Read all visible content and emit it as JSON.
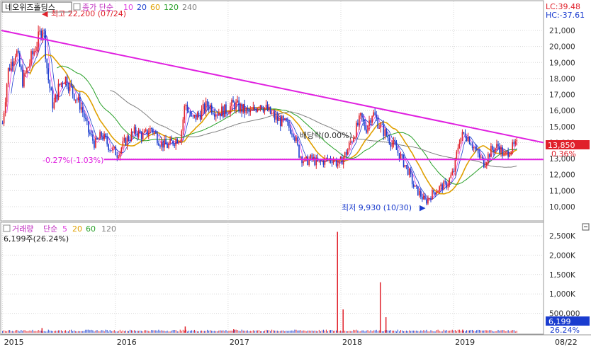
{
  "header": {
    "stock_name": "네오위즈홀딩스",
    "price_series_label": "종가 단순",
    "ma_periods": [
      "10",
      "20",
      "60",
      "120",
      "240"
    ],
    "ma_colors": [
      "#e040e0",
      "#1a3ccf",
      "#e0a000",
      "#28a028",
      "#808080"
    ]
  },
  "right_badges": {
    "lc_text": "LC:39.48",
    "hc_text": "HC:-37.61"
  },
  "annotations": {
    "high_label": "최고 22,200 (07/24)",
    "low_label": "최저 9,930 (10/30)",
    "dividend_label": "배당락(0.00%)",
    "support_label": "-0.27%(-1.03%)"
  },
  "current": {
    "price_text": "13,850",
    "change_text": "0.36%",
    "volume_text": "6,199",
    "volume_pct_text": "26.24%"
  },
  "volume_panel": {
    "label": "거래량",
    "ma_label": "단순",
    "ma_periods": [
      "5",
      "20",
      "60",
      "120"
    ],
    "ma_colors": [
      "#e040e0",
      "#e0a000",
      "#28a028",
      "#808080"
    ],
    "current_text": "6,199주(26.24%)",
    "collapse_icon": "minus-box-icon"
  },
  "colors": {
    "up": "#e0202a",
    "down": "#1a3ccf",
    "trendline": "#e020e0",
    "price_badge": "#e0202a",
    "volume_badge": "#1a3ccf"
  },
  "chart_data": {
    "type": "candlestick",
    "price_axis": {
      "ticks": [
        10000,
        11000,
        12000,
        13000,
        14000,
        15000,
        16000,
        17000,
        18000,
        19000,
        20000,
        21000
      ],
      "tick_labels": [
        "10,000",
        "11,000",
        "12,000",
        "13,000",
        "14,000",
        "15,000",
        "16,000",
        "17,000",
        "18,000",
        "19,000",
        "20,000",
        "21,000"
      ]
    },
    "volume_axis": {
      "ticks": [
        500000,
        1000000,
        1500000,
        2000000,
        2500000
      ],
      "tick_labels": [
        "500,000",
        "1,000K",
        "1,500K",
        "2,000K",
        "2,500K"
      ]
    },
    "x_labels": [
      "2015",
      "2016",
      "2017",
      "2018",
      "2019",
      "08/22"
    ],
    "x_label_dates": [
      2015.0,
      2016.0,
      2017.0,
      2018.0,
      2019.0,
      2019.64
    ],
    "price_path": [
      {
        "t": 2015.0,
        "p": 15200
      },
      {
        "t": 2015.05,
        "p": 18500
      },
      {
        "t": 2015.12,
        "p": 19800
      },
      {
        "t": 2015.18,
        "p": 17800
      },
      {
        "t": 2015.25,
        "p": 19200
      },
      {
        "t": 2015.32,
        "p": 20500
      },
      {
        "t": 2015.36,
        "p": 21400
      },
      {
        "t": 2015.4,
        "p": 18200
      },
      {
        "t": 2015.45,
        "p": 16200
      },
      {
        "t": 2015.5,
        "p": 17500
      },
      {
        "t": 2015.55,
        "p": 18100
      },
      {
        "t": 2015.62,
        "p": 17200
      },
      {
        "t": 2015.7,
        "p": 16200
      },
      {
        "t": 2015.76,
        "p": 14700
      },
      {
        "t": 2015.82,
        "p": 13900
      },
      {
        "t": 2015.88,
        "p": 14500
      },
      {
        "t": 2015.95,
        "p": 13700
      },
      {
        "t": 2016.02,
        "p": 13300
      },
      {
        "t": 2016.1,
        "p": 14200
      },
      {
        "t": 2016.18,
        "p": 14700
      },
      {
        "t": 2016.25,
        "p": 14400
      },
      {
        "t": 2016.32,
        "p": 14900
      },
      {
        "t": 2016.4,
        "p": 14000
      },
      {
        "t": 2016.46,
        "p": 13800
      },
      {
        "t": 2016.52,
        "p": 14100
      },
      {
        "t": 2016.58,
        "p": 14400
      },
      {
        "t": 2016.62,
        "p": 16500
      },
      {
        "t": 2016.68,
        "p": 15400
      },
      {
        "t": 2016.75,
        "p": 15800
      },
      {
        "t": 2016.82,
        "p": 16400
      },
      {
        "t": 2016.9,
        "p": 15900
      },
      {
        "t": 2016.98,
        "p": 16000
      },
      {
        "t": 2017.05,
        "p": 16400
      },
      {
        "t": 2017.12,
        "p": 16100
      },
      {
        "t": 2017.2,
        "p": 15800
      },
      {
        "t": 2017.28,
        "p": 16500
      },
      {
        "t": 2017.35,
        "p": 16000
      },
      {
        "t": 2017.42,
        "p": 15500
      },
      {
        "t": 2017.5,
        "p": 15200
      },
      {
        "t": 2017.58,
        "p": 14700
      },
      {
        "t": 2017.63,
        "p": 13300
      },
      {
        "t": 2017.68,
        "p": 12800
      },
      {
        "t": 2017.74,
        "p": 13000
      },
      {
        "t": 2017.8,
        "p": 12700
      },
      {
        "t": 2017.86,
        "p": 12900
      },
      {
        "t": 2017.93,
        "p": 13000
      },
      {
        "t": 2017.98,
        "p": 12600
      },
      {
        "t": 2018.05,
        "p": 13400
      },
      {
        "t": 2018.12,
        "p": 14600
      },
      {
        "t": 2018.18,
        "p": 15600
      },
      {
        "t": 2018.22,
        "p": 14800
      },
      {
        "t": 2018.28,
        "p": 15900
      },
      {
        "t": 2018.34,
        "p": 15100
      },
      {
        "t": 2018.4,
        "p": 14500
      },
      {
        "t": 2018.47,
        "p": 13800
      },
      {
        "t": 2018.53,
        "p": 13100
      },
      {
        "t": 2018.6,
        "p": 12200
      },
      {
        "t": 2018.65,
        "p": 11200
      },
      {
        "t": 2018.7,
        "p": 10800
      },
      {
        "t": 2018.75,
        "p": 10300
      },
      {
        "t": 2018.82,
        "p": 10900
      },
      {
        "t": 2018.88,
        "p": 11200
      },
      {
        "t": 2018.94,
        "p": 11400
      },
      {
        "t": 2019.0,
        "p": 12200
      },
      {
        "t": 2019.05,
        "p": 14200
      },
      {
        "t": 2019.1,
        "p": 14600
      },
      {
        "t": 2019.15,
        "p": 14100
      },
      {
        "t": 2019.2,
        "p": 13400
      },
      {
        "t": 2019.27,
        "p": 12700
      },
      {
        "t": 2019.33,
        "p": 13500
      },
      {
        "t": 2019.4,
        "p": 13800
      },
      {
        "t": 2019.45,
        "p": 13100
      },
      {
        "t": 2019.5,
        "p": 13600
      },
      {
        "t": 2019.56,
        "p": 13850
      }
    ],
    "trendlines": [
      {
        "name": "resistance",
        "from": {
          "t": 2014.99,
          "p": 21000
        },
        "to": {
          "t": 2019.68,
          "p": 14000
        }
      },
      {
        "name": "support",
        "from": {
          "t": 2015.9,
          "p": 12950
        },
        "to": {
          "t": 2019.64,
          "p": 12950
        }
      }
    ],
    "volume_spikes": [
      {
        "t": 2015.35,
        "v": 120000
      },
      {
        "t": 2016.62,
        "v": 160000
      },
      {
        "t": 2017.05,
        "v": 90000
      },
      {
        "t": 2017.97,
        "v": 2600000
      },
      {
        "t": 2018.02,
        "v": 600000
      },
      {
        "t": 2018.35,
        "v": 1300000
      },
      {
        "t": 2018.4,
        "v": 400000
      },
      {
        "t": 2019.08,
        "v": 80000
      }
    ],
    "high": {
      "t": 2015.36,
      "p": 22200
    },
    "low": {
      "t": 2018.75,
      "p": 9930
    }
  }
}
